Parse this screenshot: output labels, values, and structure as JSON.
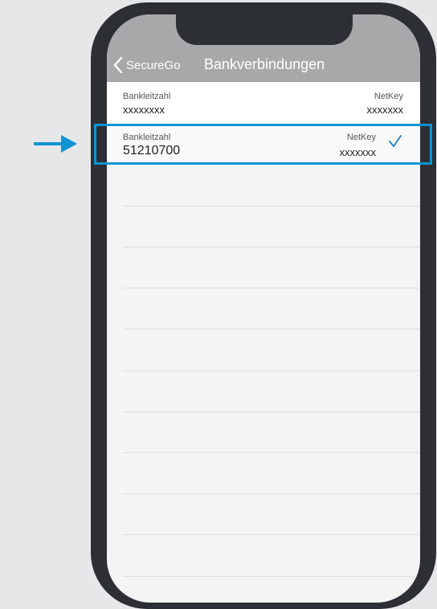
{
  "navbar": {
    "back_label": "SecureGo",
    "title": "Bankverbindungen"
  },
  "rows": [
    {
      "left_label": "Bankleitzahl",
      "left_value": "xxxxxxxx",
      "right_label": "NetKey",
      "right_value": "xxxxxxx",
      "selected": false
    },
    {
      "left_label": "Bankleitzahl",
      "left_value": "51210700",
      "right_label": "NetKey",
      "right_value": "xxxxxxx",
      "selected": true
    }
  ],
  "colors": {
    "highlight": "#0e94d2",
    "navbar": "#a7a8aa",
    "phone_frame": "#2c2f33"
  }
}
